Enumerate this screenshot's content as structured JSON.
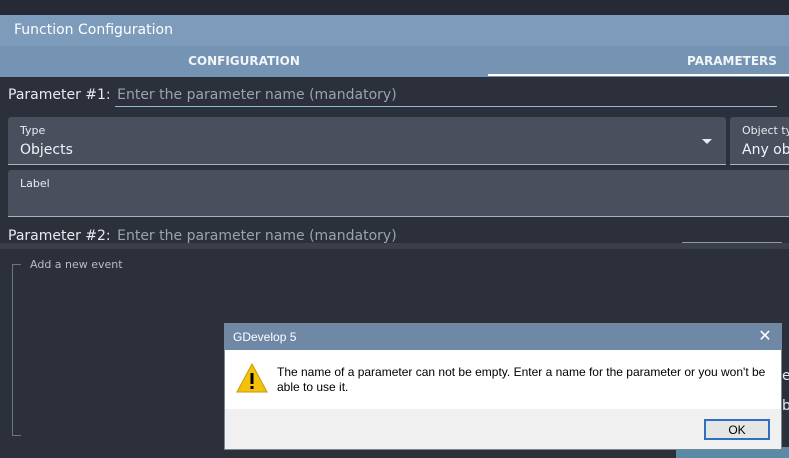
{
  "window": {
    "title": "Function Configuration"
  },
  "tabs": [
    {
      "label": "CONFIGURATION",
      "active": false
    },
    {
      "label": "PARAMETERS",
      "active": true
    }
  ],
  "parameters": [
    {
      "label": "Parameter #1:",
      "name_placeholder": "Enter the parameter name (mandatory)",
      "type_label": "Type",
      "type_value": "Objects",
      "object_type_label": "Object ty",
      "object_type_value": "Any ob",
      "label_field_label": "Label"
    },
    {
      "label": "Parameter #2:",
      "name_placeholder": "Enter the parameter name (mandatory)"
    }
  ],
  "events": {
    "add_label": "Add a new event"
  },
  "dialog": {
    "title": "GDevelop 5",
    "close_glyph": "✕",
    "message": "The name of a parameter can not be empty. Enter a name for the parameter or you won't be able to use it.",
    "ok_label": "OK",
    "icon": "warning-icon"
  },
  "right_peek": [
    "e",
    "b"
  ],
  "colors": {
    "titlebar": "#7d9bbb",
    "tabs": "#7593b2",
    "background": "#2c303b",
    "field": "#494f5c",
    "dialog_title": "#6e88a6",
    "warning": "#f4c20d"
  }
}
